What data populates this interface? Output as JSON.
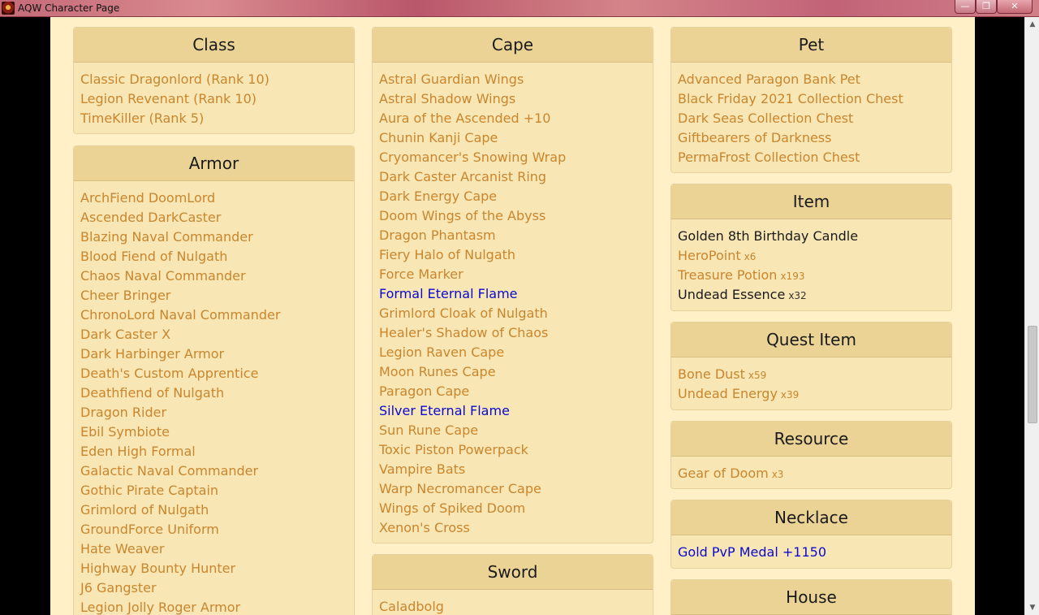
{
  "window": {
    "title": "AQW Character Page",
    "min_glyph": "—",
    "max_glyph": "❐",
    "close_glyph": "✕"
  },
  "scrollbar": {
    "up_glyph": "▲",
    "down_glyph": "▼"
  },
  "panels": {
    "class": {
      "title": "Class",
      "items": [
        {
          "name": "Classic Dragonlord (Rank 10)"
        },
        {
          "name": "Legion Revenant (Rank 10)"
        },
        {
          "name": "TimeKiller (Rank 5)"
        }
      ]
    },
    "armor": {
      "title": "Armor",
      "items": [
        {
          "name": "ArchFiend DoomLord"
        },
        {
          "name": "Ascended DarkCaster"
        },
        {
          "name": "Blazing Naval Commander"
        },
        {
          "name": "Blood Fiend of Nulgath"
        },
        {
          "name": "Chaos Naval Commander"
        },
        {
          "name": "Cheer Bringer"
        },
        {
          "name": "ChronoLord Naval Commander"
        },
        {
          "name": "Dark Caster X"
        },
        {
          "name": "Dark Harbinger Armor"
        },
        {
          "name": "Death's Custom Apprentice"
        },
        {
          "name": "Deathfiend of Nulgath"
        },
        {
          "name": "Dragon Rider"
        },
        {
          "name": "Ebil Symbiote"
        },
        {
          "name": "Eden High Formal"
        },
        {
          "name": "Galactic Naval Commander"
        },
        {
          "name": "Gothic Pirate Captain"
        },
        {
          "name": "Grimlord of Nulgath"
        },
        {
          "name": "GroundForce Uniform"
        },
        {
          "name": "Hate Weaver"
        },
        {
          "name": "Highway Bounty Hunter"
        },
        {
          "name": "J6 Gangster"
        },
        {
          "name": "Legion Jolly Roger Armor"
        }
      ]
    },
    "cape": {
      "title": "Cape",
      "items": [
        {
          "name": "Astral Guardian Wings"
        },
        {
          "name": "Astral Shadow Wings"
        },
        {
          "name": "Aura of the Ascended +10"
        },
        {
          "name": "Chunin Kanji Cape"
        },
        {
          "name": "Cryomancer's Snowing Wrap"
        },
        {
          "name": "Dark Caster Arcanist Ring"
        },
        {
          "name": "Dark Energy Cape"
        },
        {
          "name": "Doom Wings of the Abyss"
        },
        {
          "name": "Dragon Phantasm"
        },
        {
          "name": "Fiery Halo of Nulgath"
        },
        {
          "name": "Force Marker"
        },
        {
          "name": "Formal Eternal Flame",
          "color": "blue"
        },
        {
          "name": "Grimlord Cloak of Nulgath"
        },
        {
          "name": "Healer's Shadow of Chaos"
        },
        {
          "name": "Legion Raven Cape"
        },
        {
          "name": "Moon Runes Cape"
        },
        {
          "name": "Paragon Cape"
        },
        {
          "name": "Silver Eternal Flame",
          "color": "blue"
        },
        {
          "name": "Sun Rune Cape"
        },
        {
          "name": "Toxic Piston Powerpack"
        },
        {
          "name": "Vampire Bats"
        },
        {
          "name": "Warp Necromancer Cape"
        },
        {
          "name": "Wings of Spiked Doom"
        },
        {
          "name": "Xenon's Cross"
        }
      ]
    },
    "sword": {
      "title": "Sword",
      "items": [
        {
          "name": "Caladbolg"
        }
      ]
    },
    "pet": {
      "title": "Pet",
      "items": [
        {
          "name": "Advanced Paragon Bank Pet"
        },
        {
          "name": "Black Friday 2021 Collection Chest"
        },
        {
          "name": "Dark Seas Collection Chest"
        },
        {
          "name": "Giftbearers of Darkness"
        },
        {
          "name": "PermaFrost Collection Chest"
        }
      ]
    },
    "item": {
      "title": "Item",
      "items": [
        {
          "name": "Golden 8th Birthday Candle",
          "color": "black"
        },
        {
          "name": "HeroPoint",
          "qty": "x6"
        },
        {
          "name": "Treasure Potion",
          "qty": "x193"
        },
        {
          "name": "Undead Essence",
          "qty": "x32",
          "color": "black"
        }
      ]
    },
    "quest_item": {
      "title": "Quest Item",
      "items": [
        {
          "name": "Bone Dust",
          "qty": "x59"
        },
        {
          "name": "Undead Energy",
          "qty": "x39"
        }
      ]
    },
    "resource": {
      "title": "Resource",
      "items": [
        {
          "name": "Gear of Doom",
          "qty": "x3"
        }
      ]
    },
    "necklace": {
      "title": "Necklace",
      "items": [
        {
          "name": "Gold PvP Medal +1150",
          "color": "blue"
        }
      ]
    },
    "house": {
      "title": "House",
      "items": []
    }
  }
}
